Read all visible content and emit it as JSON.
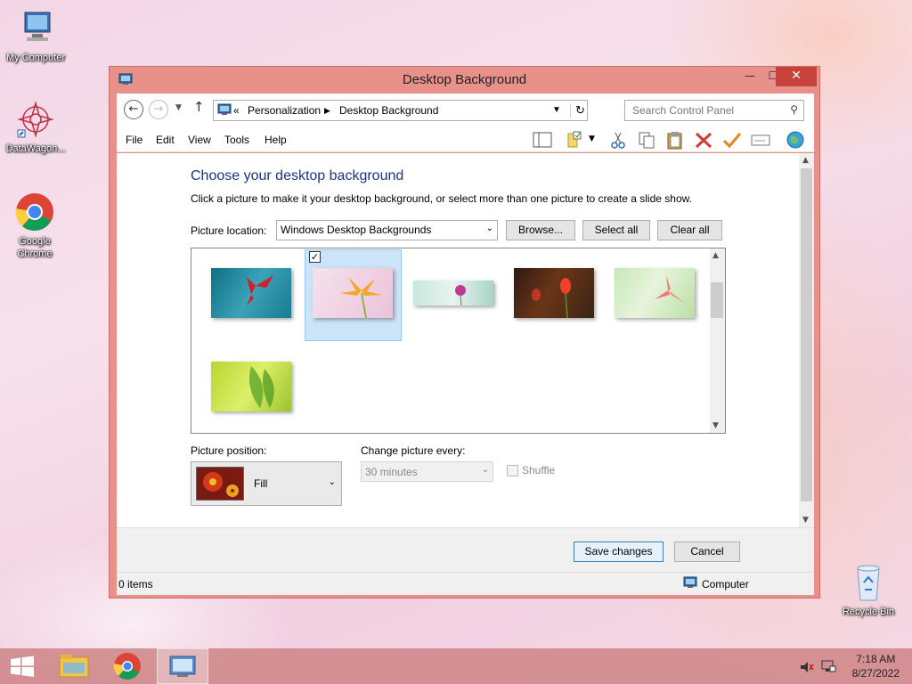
{
  "desktop": {
    "icons": [
      {
        "label": "My Computer"
      },
      {
        "label": "DataWagon..."
      },
      {
        "label": "Google Chrome"
      },
      {
        "label": "Recycle Bin"
      }
    ]
  },
  "window": {
    "title": "Desktop Background",
    "controls": {
      "minimize": "—",
      "maximize": "☐",
      "close": "✕"
    }
  },
  "address": {
    "prefix": "«",
    "crumbs": [
      "Personalization",
      "Desktop Background"
    ],
    "search_placeholder": "Search Control Panel"
  },
  "menu": [
    "File",
    "Edit",
    "View",
    "Tools",
    "Help"
  ],
  "content": {
    "heading": "Choose your desktop background",
    "description": "Click a picture to make it your desktop background, or select more than one picture to create a slide show.",
    "picture_location_label": "Picture location:",
    "picture_location_value": "Windows Desktop Backgrounds",
    "browse": "Browse...",
    "select_all": "Select all",
    "clear_all": "Clear all",
    "picture_position_label": "Picture position:",
    "picture_position_value": "Fill",
    "change_every_label": "Change picture every:",
    "change_every_value": "30 minutes",
    "shuffle_label": "Shuffle",
    "thumbnails_selected_index": 1
  },
  "footer": {
    "save": "Save changes",
    "cancel": "Cancel"
  },
  "status": {
    "items": "0 items",
    "location": "Computer"
  },
  "taskbar": {
    "time": "7:18 AM",
    "date": "8/27/2022"
  }
}
